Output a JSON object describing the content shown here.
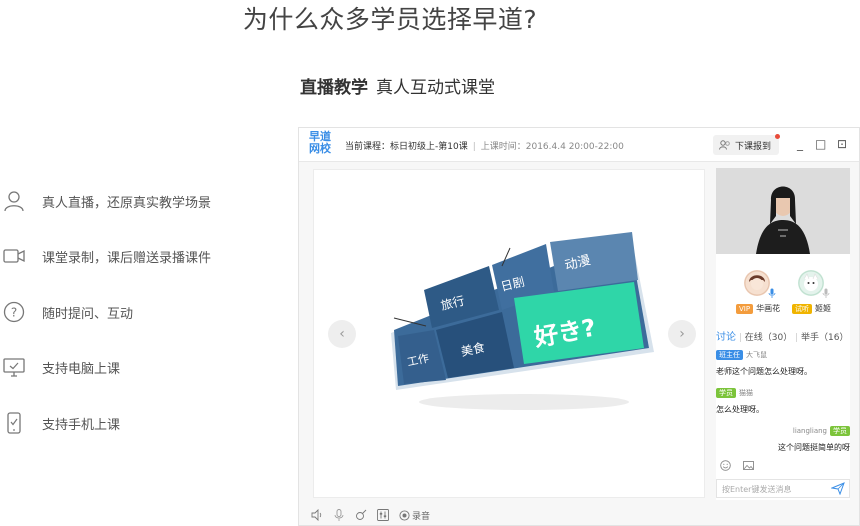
{
  "headline": "为什么众多学员选择早道?",
  "subhead": {
    "bold": "直播教学",
    "text": "真人互动式课堂"
  },
  "features": [
    {
      "icon": "person-icon",
      "label": "真人直播，还原真实教学场景"
    },
    {
      "icon": "video-camera-icon",
      "label": "课堂录制，课后赠送录播课件"
    },
    {
      "icon": "question-icon",
      "label": "随时提问、互动"
    },
    {
      "icon": "monitor-icon",
      "label": "支持电脑上课"
    },
    {
      "icon": "phone-icon",
      "label": "支持手机上课"
    }
  ],
  "app": {
    "logo_line1": "早道",
    "logo_line2": "网校",
    "course_label": "当前课程：标日初级上-第10课",
    "time_label": "上课时间：2016.4.4 20:00-22:00",
    "report_button": "下课报到",
    "window_controls": {
      "minimize": "_",
      "restore": "□",
      "close": "⊡"
    },
    "slide": {
      "tiles": [
        "旅行",
        "日剧",
        "动漫",
        "工作",
        "美食",
        "好き?"
      ],
      "prev_arrow": "‹",
      "next_arrow": "›"
    },
    "participants": [
      {
        "badge": "VIP",
        "name": "华画花"
      },
      {
        "badge": "试听",
        "name": "姬姬"
      }
    ],
    "tabs": {
      "discussion": "讨论",
      "online": "在线（30）",
      "raise_hand": "举手（16）"
    },
    "messages": [
      {
        "role": "班主任",
        "name": "大飞鼠",
        "text": "老师这个问题怎么处理呀。",
        "align": "left"
      },
      {
        "role": "学员",
        "name": "猫猫",
        "text": "怎么处理呀。",
        "align": "left"
      },
      {
        "role": "学员",
        "name": "liangliang",
        "text": "这个问题挺简单的呀",
        "align": "right"
      }
    ],
    "input_placeholder": "按Enter键发送消息",
    "bottom": {
      "record_label": "录音"
    },
    "colors": {
      "accent": "#3a8ee6",
      "teal": "#2fd6a8",
      "vip": "#f39c3d",
      "trial": "#f0b400",
      "student": "#7cc43b",
      "teacher": "#3a8ee6"
    }
  }
}
